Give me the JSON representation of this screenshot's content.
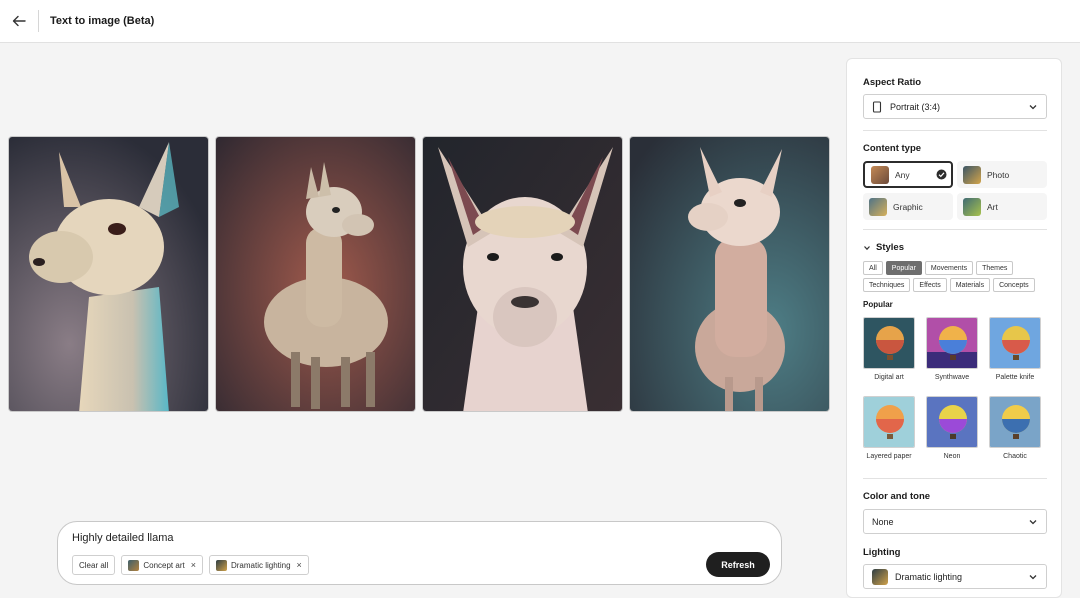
{
  "header": {
    "title": "Text to image (Beta)"
  },
  "gallery": {
    "images": [
      {
        "name": "Llama result 1"
      },
      {
        "name": "Llama result 2"
      },
      {
        "name": "Llama result 3"
      },
      {
        "name": "Llama result 4"
      }
    ]
  },
  "prompt": {
    "text": "Highly detailed llama",
    "clear_label": "Clear all",
    "chips": [
      {
        "label": "Concept art"
      },
      {
        "label": "Dramatic lighting"
      }
    ],
    "refresh_label": "Refresh"
  },
  "panel": {
    "aspect_ratio": {
      "title": "Aspect Ratio",
      "value": "Portrait (3:4)"
    },
    "content_type": {
      "title": "Content type",
      "options": [
        {
          "label": "Any",
          "selected": true
        },
        {
          "label": "Photo",
          "selected": false
        },
        {
          "label": "Graphic",
          "selected": false
        },
        {
          "label": "Art",
          "selected": false
        }
      ]
    },
    "styles": {
      "title": "Styles",
      "tabs": [
        "All",
        "Popular",
        "Movements",
        "Themes",
        "Techniques",
        "Effects",
        "Materials",
        "Concepts"
      ],
      "active_tab": "Popular",
      "subheading": "Popular",
      "items": [
        {
          "label": "Digital art"
        },
        {
          "label": "Synthwave"
        },
        {
          "label": "Palette knife"
        },
        {
          "label": "Layered paper"
        },
        {
          "label": "Neon"
        },
        {
          "label": "Chaotic"
        }
      ]
    },
    "color_tone": {
      "title": "Color and tone",
      "value": "None"
    },
    "lighting": {
      "title": "Lighting",
      "value": "Dramatic lighting"
    }
  },
  "colors": {
    "accent_dark": "#1f1f1f",
    "panel_bg": "#ffffff",
    "page_bg": "#f4f4f4"
  }
}
